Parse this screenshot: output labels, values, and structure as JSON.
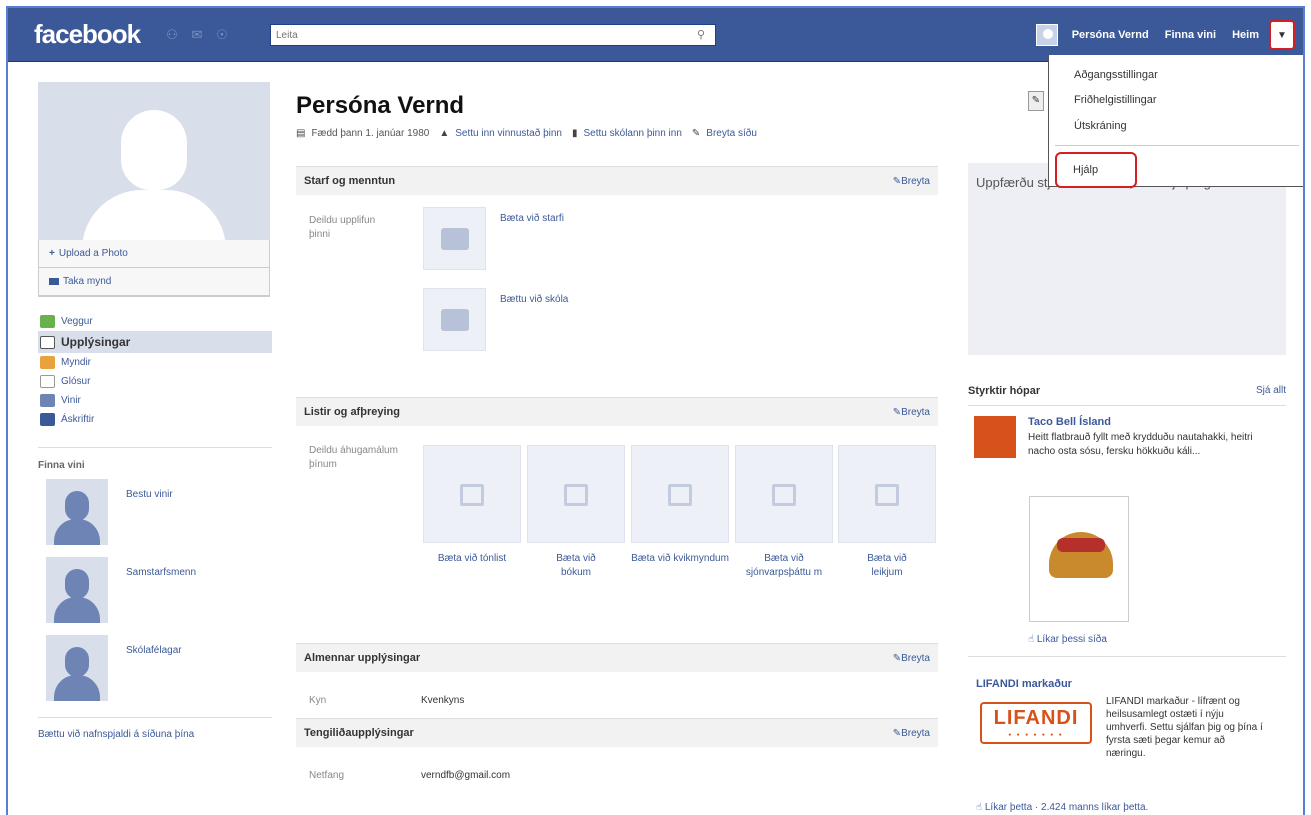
{
  "topbar": {
    "logo": "facebook",
    "search_placeholder": "Leita",
    "nav_user": "Persóna Vernd",
    "nav_find_friends": "Finna vini",
    "nav_home": "Heim"
  },
  "dropdown": {
    "items": [
      "Aðgangsstillingar",
      "Friðhelgistillingar",
      "Útskráning"
    ],
    "help": "Hjálp"
  },
  "left": {
    "upload_photo": "Upload a Photo",
    "take_photo": "Taka mynd",
    "nav": [
      {
        "label": "Veggur",
        "icon": "wall-icon"
      },
      {
        "label": "Upplýsingar",
        "icon": "info-icon"
      },
      {
        "label": "Myndir",
        "icon": "photos-icon"
      },
      {
        "label": "Glósur",
        "icon": "notes-icon"
      },
      {
        "label": "Vinir",
        "icon": "friends-icon"
      },
      {
        "label": "Áskriftir",
        "icon": "subscriptions-icon"
      }
    ],
    "find_friends_heading": "Finna vini",
    "friend_rows": [
      "Bestu vinir",
      "Samstarfsmenn",
      "Skólafélagar"
    ],
    "bottom_link": "Bættu við nafnspjaldi á síðuna þína"
  },
  "main": {
    "name": "Persóna Vernd",
    "born": "Fædd þann 1. janúar 1980",
    "add_work": "Settu inn vinnustað þinn",
    "add_school": "Settu skólann þinn inn",
    "edit_page": "Breyta síðu",
    "sections": {
      "work": {
        "title": "Starf og menntun",
        "edit": "Breyta",
        "label": "Deildu upplifun þinni",
        "add_job": "Bæta við starfi",
        "add_school": "Bættu við skóla"
      },
      "arts": {
        "title": "Listir og afþreying",
        "edit": "Breyta",
        "label": "Deildu áhugamálum þínum",
        "tiles": [
          "Bæta við tónlist",
          "Bæta við bókum",
          "Bæta við kvikmyndum",
          "Bæta við sjónvarpsþáttu m",
          "Bæta við leikjum"
        ]
      },
      "general": {
        "title": "Almennar upplýsingar",
        "edit": "Breyta",
        "key": "Kyn",
        "value": "Kvenkyns"
      },
      "contact": {
        "title": "Tengiliðaupplýsingar",
        "edit": "Breyta",
        "key": "Netfang",
        "value": "verndfb@gmail.com"
      }
    }
  },
  "right": {
    "update_text": "Uppfærðu stjórnaðu vinum, fáðu hjálp og fleira.",
    "sponsored": "Styrktir hópar",
    "see_all": "Sjá allt",
    "ad1": {
      "title": "Taco Bell Ísland",
      "text": "Heitt flatbrauð fyllt með krydduðu nautahakki, heitri nacho osta sósu, fersku hökkuðu káli...",
      "like": "Líkar þessi síða"
    },
    "ad2": {
      "title": "LIFANDI markaður",
      "logo_text": "LIFANDI",
      "text": "LIFANDI markaður - lífrænt og heilsusamlegt ostæti í nýju umhverfi. Settu sjálfan þig og þína í fyrsta sæti þegar kemur að næringu.",
      "like": "Líkar þetta · 2.424 manns líkar þetta."
    }
  },
  "colors": {
    "brand": "#3b5998",
    "highlight": "#d21f1f"
  }
}
